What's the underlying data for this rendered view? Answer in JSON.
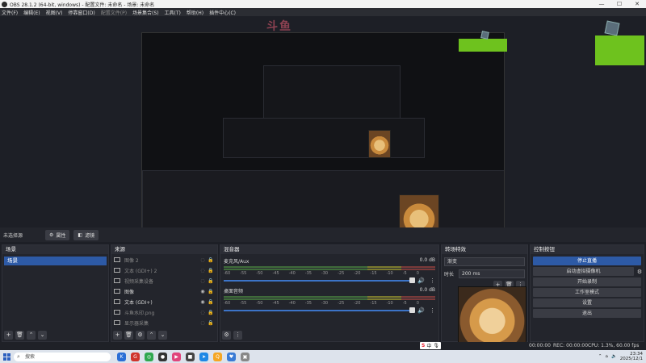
{
  "window": {
    "title": "OBS 28.1.2 (64-bit, windows) - 配置文件: 未命名 - 场景: 未命名",
    "controls": [
      "—",
      "☐",
      "✕"
    ]
  },
  "menu": [
    "文件(F)",
    "编辑(E)",
    "视图(V)",
    "停靠窗口(D)",
    "配置文件(P)",
    "场景集合(S)",
    "工具(T)",
    "帮助(H)",
    "插件中心(C)"
  ],
  "toolbar": {
    "no_source": "未选择源",
    "properties_label": "属性",
    "filters_label": "滤镜"
  },
  "scenes": {
    "header": "场景",
    "items": [
      "场景"
    ]
  },
  "sources": {
    "header": "来源",
    "items": [
      {
        "name": "图像 2",
        "dim": true,
        "visible_icon": "eye-off-icon"
      },
      {
        "name": "文本 (GDI+) 2",
        "dim": true,
        "visible_icon": "eye-off-icon"
      },
      {
        "name": "视频采集设备",
        "dim": true,
        "visible_icon": "eye-off-icon"
      },
      {
        "name": "图像",
        "dim": false,
        "visible_icon": "eye-icon"
      },
      {
        "name": "文本 (GDI+)",
        "dim": false,
        "visible_icon": "eye-icon"
      },
      {
        "name": "斗鱼水印.png",
        "dim": true,
        "visible_icon": "eye-off-icon"
      },
      {
        "name": "显示器采集",
        "dim": true,
        "visible_icon": "eye-off-icon"
      }
    ]
  },
  "mixer": {
    "header": "混音器",
    "channels": [
      {
        "name": "麦克风/Aux",
        "db": "0.0 dB"
      },
      {
        "name": "桌面音频",
        "db": "0.0 dB"
      }
    ],
    "ticks": [
      "-60",
      "-55",
      "-50",
      "-45",
      "-40",
      "-35",
      "-30",
      "-25",
      "-20",
      "-15",
      "-10",
      "-5",
      "0"
    ]
  },
  "transitions": {
    "header": "转场特效",
    "selected": "渐变",
    "duration_label": "时长",
    "duration": "200 ms"
  },
  "controls": {
    "header": "控制按钮",
    "buttons": [
      "停止直播",
      "启动虚拟摄像机",
      "开始录制",
      "工作室模式",
      "设置",
      "退出"
    ]
  },
  "status": {
    "live": "00:00:00",
    "rec": "REC: 00:00:00",
    "cpu": "CPU: 1.3%, 60.00 fps"
  },
  "ime": {
    "lang": "中"
  },
  "taskbar": {
    "search_placeholder": "搜索",
    "time": "23:34",
    "date": "2025/12/1"
  },
  "colors": {
    "accent": "#2d5aa6",
    "green": "#6ec21e",
    "panel": "#23252c"
  }
}
